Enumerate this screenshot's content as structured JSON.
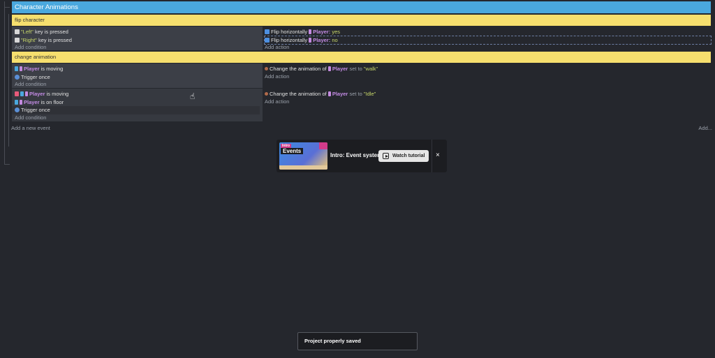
{
  "group": {
    "title": "Character Animations"
  },
  "comments": {
    "flip": "flip character",
    "change": "change animation"
  },
  "ev1": {
    "cond1": {
      "key": "\"Left\"",
      "rest": "key is pressed"
    },
    "cond2": {
      "key": "\"Right\"",
      "rest": "key is pressed"
    },
    "add_condition": "Add condition",
    "act1": {
      "verb": "Flip horizontally",
      "obj": "Player:",
      "val": "yes"
    },
    "act2": {
      "verb": "Flip horizontally",
      "obj": "Player:",
      "val": "no"
    },
    "add_action": "Add action"
  },
  "ev2": {
    "cond1": {
      "obj": "Player",
      "rest": "is moving"
    },
    "cond2": "Trigger once",
    "add_condition": "Add condition",
    "act1": {
      "verb": "Change the animation of",
      "obj": "Player",
      "mid": "set to",
      "val": "\"walk\""
    },
    "add_action": "Add action"
  },
  "ev3": {
    "cond1": {
      "obj": "Player",
      "rest": "is moving"
    },
    "cond2": {
      "obj": "Player",
      "rest": "is on floor"
    },
    "cond3": "Trigger once",
    "add_condition": "Add condition",
    "act1": {
      "verb": "Change the animation of",
      "obj": "Player",
      "mid": "set to",
      "val": "\"Idle\""
    },
    "add_action": "Add action"
  },
  "footer": {
    "add_event": "Add a new event",
    "add_more": "Add..."
  },
  "tutorial": {
    "badge_small": "Intro",
    "badge_big": "Events",
    "title": "Intro: Event system",
    "button": "Watch tutorial",
    "close": "×"
  },
  "toast": {
    "message": "Project properly saved"
  }
}
